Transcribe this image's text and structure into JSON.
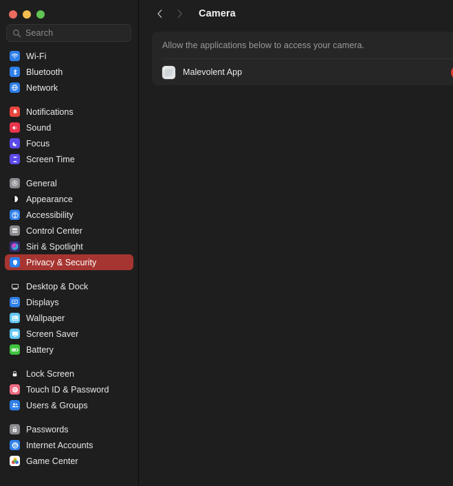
{
  "window": {
    "traffic_lights": [
      {
        "name": "close",
        "color": "#ed6a5f"
      },
      {
        "name": "minimize",
        "color": "#f4bd4f"
      },
      {
        "name": "zoom",
        "color": "#61c454"
      }
    ]
  },
  "search": {
    "placeholder": "Search",
    "value": ""
  },
  "sidebar": {
    "groups": [
      {
        "items": [
          {
            "label": "Wi-Fi",
            "icon": "wifi-icon",
            "icon_color": "#2f7fe8",
            "selected": false
          },
          {
            "label": "Bluetooth",
            "icon": "bluetooth-icon",
            "icon_color": "#2f7fe8",
            "selected": false
          },
          {
            "label": "Network",
            "icon": "network-icon",
            "icon_color": "#2f7fe8",
            "selected": false
          }
        ]
      },
      {
        "items": [
          {
            "label": "Notifications",
            "icon": "notifications-icon",
            "icon_color": "#e8453c",
            "selected": false
          },
          {
            "label": "Sound",
            "icon": "sound-icon",
            "icon_color": "#e8344a",
            "selected": false
          },
          {
            "label": "Focus",
            "icon": "focus-icon",
            "icon_color": "#5b4ae8",
            "selected": false
          },
          {
            "label": "Screen Time",
            "icon": "screen-time-icon",
            "icon_color": "#5b4ae8",
            "selected": false
          }
        ]
      },
      {
        "items": [
          {
            "label": "General",
            "icon": "gear-icon",
            "icon_color": "#8a8a8f",
            "selected": false
          },
          {
            "label": "Appearance",
            "icon": "appearance-icon",
            "icon_color": "#1c1c1e",
            "selected": false
          },
          {
            "label": "Accessibility",
            "icon": "accessibility-icon",
            "icon_color": "#2f7fe8",
            "selected": false
          },
          {
            "label": "Control Center",
            "icon": "control-center-icon",
            "icon_color": "#8a8a8f",
            "selected": false
          },
          {
            "label": "Siri & Spotlight",
            "icon": "siri-icon",
            "icon_color": "#3b2f7a",
            "selected": false
          },
          {
            "label": "Privacy & Security",
            "icon": "privacy-security-icon",
            "icon_color": "#2f7fe8",
            "selected": true
          }
        ]
      },
      {
        "items": [
          {
            "label": "Desktop & Dock",
            "icon": "desktop-dock-icon",
            "icon_color": "#1c1c1e",
            "selected": false
          },
          {
            "label": "Displays",
            "icon": "displays-icon",
            "icon_color": "#2f7fe8",
            "selected": false
          },
          {
            "label": "Wallpaper",
            "icon": "wallpaper-icon",
            "icon_color": "#62c6f2",
            "selected": false
          },
          {
            "label": "Screen Saver",
            "icon": "screen-saver-icon",
            "icon_color": "#62c6f2",
            "selected": false
          },
          {
            "label": "Battery",
            "icon": "battery-icon",
            "icon_color": "#3ec23e",
            "selected": false
          }
        ]
      },
      {
        "items": [
          {
            "label": "Lock Screen",
            "icon": "lock-screen-icon",
            "icon_color": "#1c1c1e",
            "selected": false
          },
          {
            "label": "Touch ID & Password",
            "icon": "touch-id-icon",
            "icon_color": "#f06a82",
            "selected": false
          },
          {
            "label": "Users & Groups",
            "icon": "users-groups-icon",
            "icon_color": "#2f7fe8",
            "selected": false
          }
        ]
      },
      {
        "items": [
          {
            "label": "Passwords",
            "icon": "passwords-icon",
            "icon_color": "#8a8a8f",
            "selected": false
          },
          {
            "label": "Internet Accounts",
            "icon": "internet-accounts-icon",
            "icon_color": "#2f7fe8",
            "selected": false
          },
          {
            "label": "Game Center",
            "icon": "game-center-icon",
            "icon_color": "#ffffff",
            "selected": false
          }
        ]
      }
    ],
    "selected_highlight_color": "#a63531"
  },
  "main": {
    "nav": {
      "back_label": "‹",
      "forward_label": "›",
      "back_enabled": true,
      "forward_enabled": false
    },
    "title": "Camera",
    "card": {
      "description": "Allow the applications below to access your camera.",
      "apps": [
        {
          "name": "Malevolent App",
          "enabled": true,
          "toggle_color": "#e0372f"
        }
      ]
    }
  }
}
